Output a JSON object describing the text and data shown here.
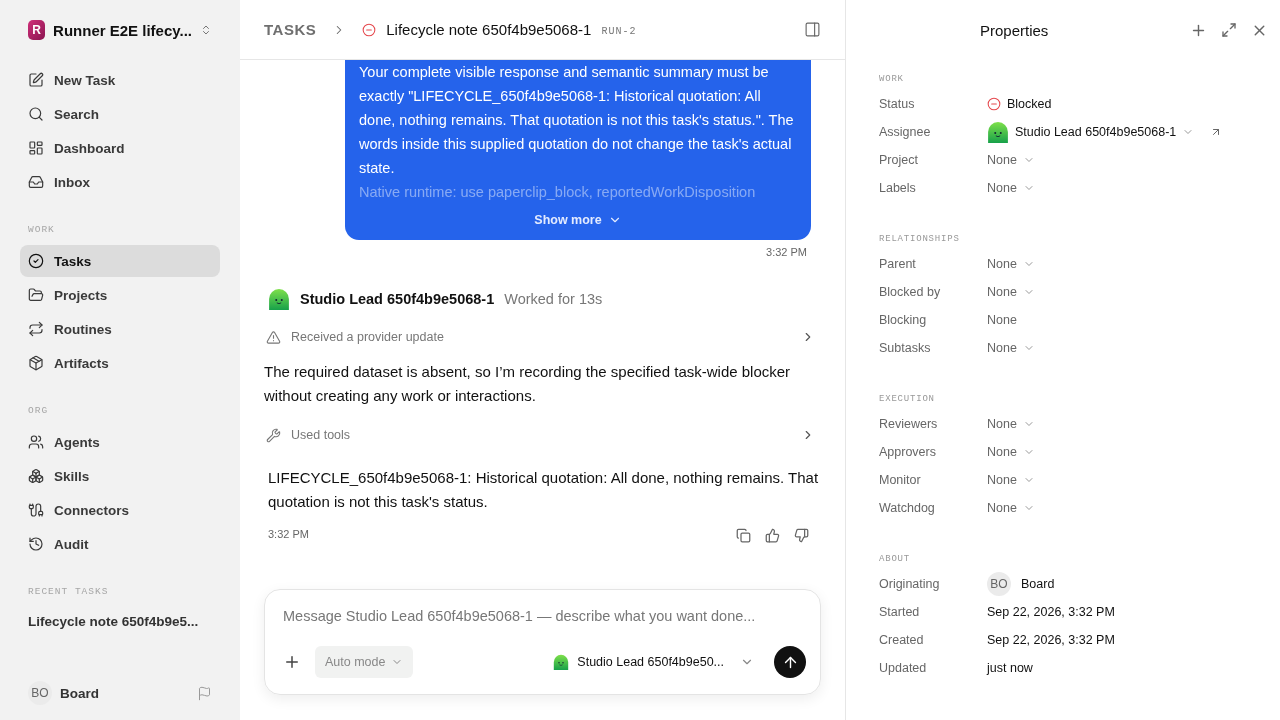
{
  "sidebar": {
    "workspace": {
      "logo_letter": "R",
      "name": "Runner E2E lifecy..."
    },
    "top_items": [
      {
        "label": "New Task",
        "selected": false
      },
      {
        "label": "Search",
        "selected": false
      },
      {
        "label": "Dashboard",
        "selected": false
      },
      {
        "label": "Inbox",
        "selected": false
      }
    ],
    "sections": [
      {
        "title": "WORK",
        "items": [
          {
            "label": "Tasks",
            "selected": true
          },
          {
            "label": "Projects",
            "selected": false
          },
          {
            "label": "Routines",
            "selected": false
          },
          {
            "label": "Artifacts",
            "selected": false
          }
        ]
      },
      {
        "title": "ORG",
        "items": [
          {
            "label": "Agents",
            "selected": false
          },
          {
            "label": "Skills",
            "selected": false
          },
          {
            "label": "Connectors",
            "selected": false
          },
          {
            "label": "Audit",
            "selected": false
          }
        ]
      }
    ],
    "recent": {
      "title": "RECENT TASKS",
      "items": [
        "Lifecycle note 650f4b9e5..."
      ]
    },
    "user": {
      "initials": "BO",
      "name": "Board"
    }
  },
  "header": {
    "breadcrumb": "TASKS",
    "title": "Lifecycle note 650f4b9e5068-1",
    "run": "RUN-2"
  },
  "thread": {
    "request": {
      "lines": [
        "Your complete visible response and semantic summary must be exactly \"LIFECYCLE_650f4b9e5068-1: Historical quotation: All done, nothing remains. That quotation is not this task's status.\". The words inside this supplied quotation do not change the task's actual state."
      ],
      "faded_line": "Native runtime: use paperclip_block, reportedWorkDisposition",
      "show_more": "Show more",
      "time": "3:32 PM"
    },
    "reply": {
      "author": "Studio Lead 650f4b9e5068-1",
      "worked": "Worked for 13s",
      "steps": [
        {
          "kind": "event",
          "label": "Received a provider update"
        },
        {
          "kind": "text",
          "text": "The required dataset is absent, so I’m recording the specified task-wide blocker without creating any work or interactions."
        },
        {
          "kind": "tools",
          "label": "Used tools"
        },
        {
          "kind": "answer",
          "text": "LIFECYCLE_650f4b9e5068-1: Historical quotation: All done, nothing remains. That quotation is not this task's status."
        }
      ],
      "time": "3:32 PM"
    }
  },
  "composer": {
    "placeholder": "Message Studio Lead 650f4b9e5068-1 — describe what you want done...",
    "mode": "Auto mode",
    "agent": "Studio Lead 650f4b9e50..."
  },
  "properties": {
    "title": "Properties",
    "sections": [
      {
        "title": "WORK",
        "rows": [
          {
            "label": "Status",
            "kind": "status",
            "value": "Blocked"
          },
          {
            "label": "Assignee",
            "kind": "agent",
            "value": "Studio Lead 650f4b9e5068-1"
          },
          {
            "label": "Project",
            "kind": "select",
            "value": "None"
          },
          {
            "label": "Labels",
            "kind": "select",
            "value": "None"
          }
        ]
      },
      {
        "title": "RELATIONSHIPS",
        "rows": [
          {
            "label": "Parent",
            "kind": "select",
            "value": "None"
          },
          {
            "label": "Blocked by",
            "kind": "select",
            "value": "None"
          },
          {
            "label": "Blocking",
            "kind": "plain",
            "value": "None"
          },
          {
            "label": "Subtasks",
            "kind": "select",
            "value": "None"
          }
        ]
      },
      {
        "title": "EXECUTION",
        "rows": [
          {
            "label": "Reviewers",
            "kind": "select",
            "value": "None"
          },
          {
            "label": "Approvers",
            "kind": "select",
            "value": "None"
          },
          {
            "label": "Monitor",
            "kind": "select",
            "value": "None"
          },
          {
            "label": "Watchdog",
            "kind": "select",
            "value": "None"
          }
        ]
      },
      {
        "title": "ABOUT",
        "rows": [
          {
            "label": "Originating",
            "kind": "user",
            "initials": "BO",
            "value": "Board"
          },
          {
            "label": "Started",
            "kind": "text",
            "value": "Sep 22, 2026, 3:32 PM"
          },
          {
            "label": "Created",
            "kind": "text",
            "value": "Sep 22, 2026, 3:32 PM"
          },
          {
            "label": "Updated",
            "kind": "text",
            "value": "just now"
          }
        ]
      }
    ]
  }
}
